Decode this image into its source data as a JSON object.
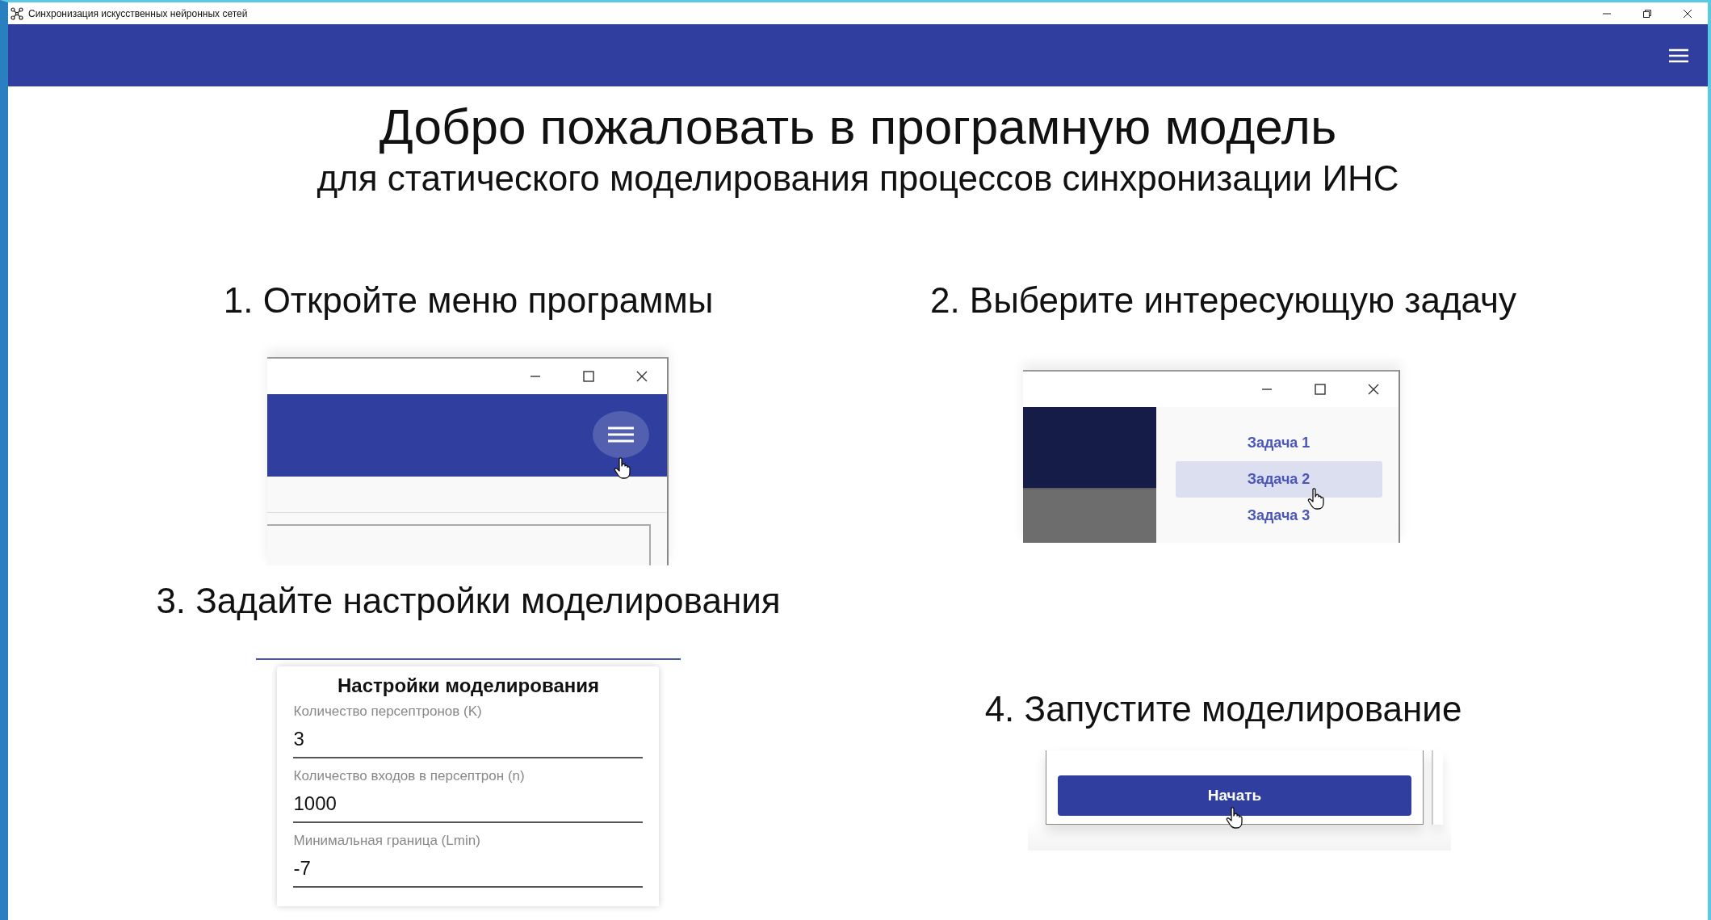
{
  "window": {
    "title": "Синхронизация искусственных нейронных сетей"
  },
  "heading": {
    "title": "Добро пожаловать в програмную модель",
    "subtitle": "для статического моделирования процессов синхронизации ИНС"
  },
  "steps": [
    {
      "label": "1. Откройте меню программы",
      "kind": "app_window"
    },
    {
      "label": "2. Выберите интересующую задачу",
      "kind": "menu",
      "items": [
        {
          "label": "Задача 1",
          "selected": false
        },
        {
          "label": "Задача 2",
          "selected": true
        },
        {
          "label": "Задача 3",
          "selected": false
        }
      ]
    },
    {
      "label": "3. Задайте настройки моделирования",
      "kind": "settings",
      "card_title": "Настройки моделирования",
      "fields": [
        {
          "label": "Количество персептронов (K)",
          "value": "3"
        },
        {
          "label": "Количество входов в персептрон (n)",
          "value": "1000"
        },
        {
          "label": "Минимальная граница (Lmin)",
          "value": "-7"
        }
      ]
    },
    {
      "label": "4. Запустите моделирование",
      "kind": "start",
      "button": "Начать"
    }
  ]
}
